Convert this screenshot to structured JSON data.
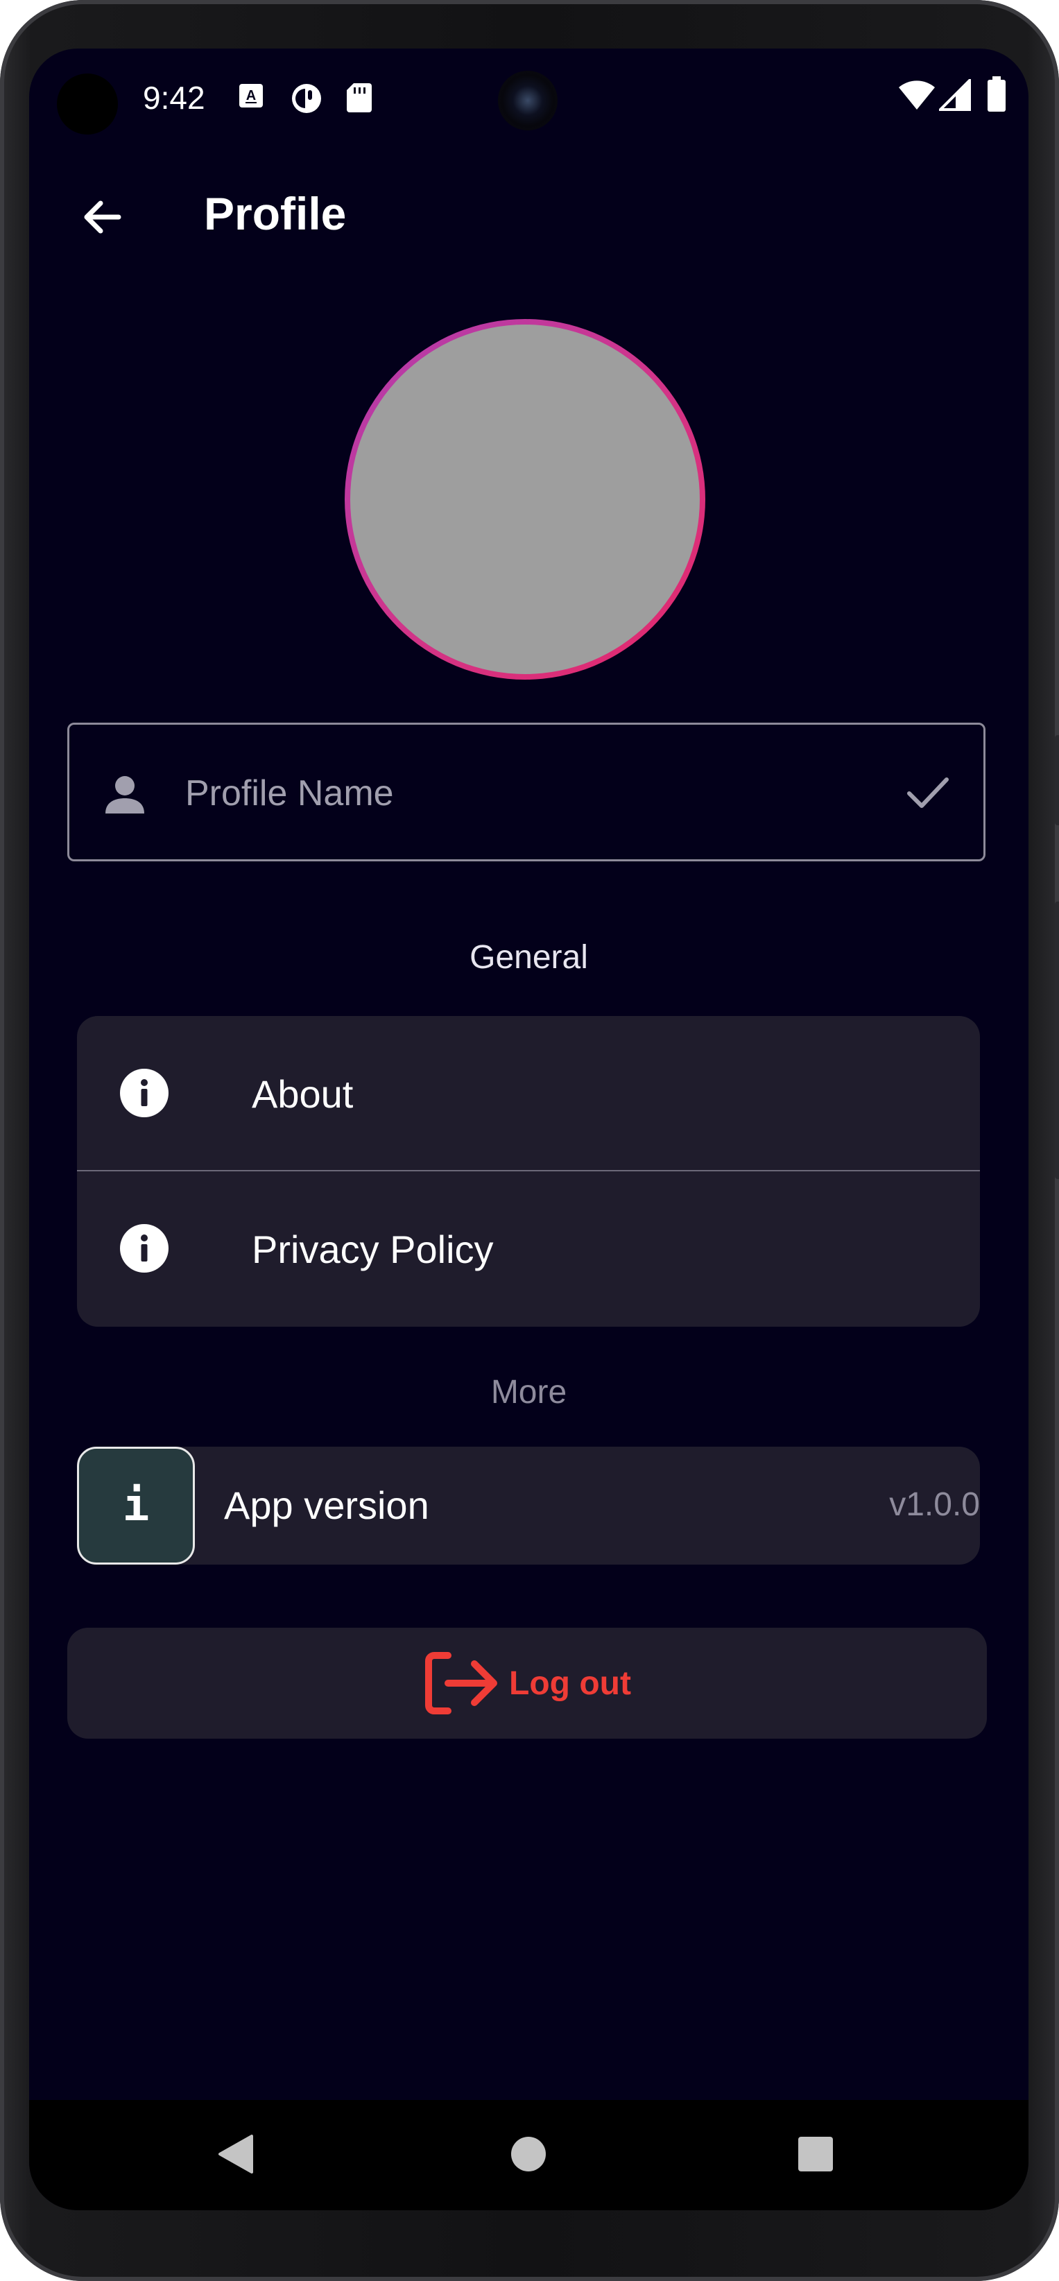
{
  "status_bar": {
    "time": "9:42",
    "left_icons": [
      "font-download-icon",
      "circle-half-icon",
      "sd-card-icon"
    ],
    "right_icons": [
      "wifi-icon",
      "signal-icon",
      "battery-icon"
    ]
  },
  "app_bar": {
    "back_icon": "arrow-left-icon",
    "title": "Profile"
  },
  "avatar": {
    "ring_colors": [
      "#b03cb0",
      "#e4286a"
    ],
    "fill_color": "#9e9e9e"
  },
  "name_field": {
    "leading_icon": "person-icon",
    "value": "",
    "placeholder": "Profile Name",
    "trailing_icon": "check-icon"
  },
  "general": {
    "title": "General",
    "items": [
      {
        "icon": "info-icon",
        "label": "About"
      },
      {
        "icon": "info-icon",
        "label": "Privacy Policy"
      }
    ]
  },
  "more": {
    "title": "More",
    "version_icon_text": "i",
    "version_label": "App version",
    "version_value": "v1.0.0"
  },
  "logout": {
    "icon": "logout-icon",
    "label": "Log out",
    "color": "#ef3c36"
  },
  "nav_bar": {
    "buttons": [
      "back-triangle-icon",
      "home-circle-icon",
      "recents-square-icon"
    ]
  },
  "colors": {
    "background": "#03001a",
    "card": "#1f1c2c",
    "accent_danger": "#ef3c36"
  }
}
